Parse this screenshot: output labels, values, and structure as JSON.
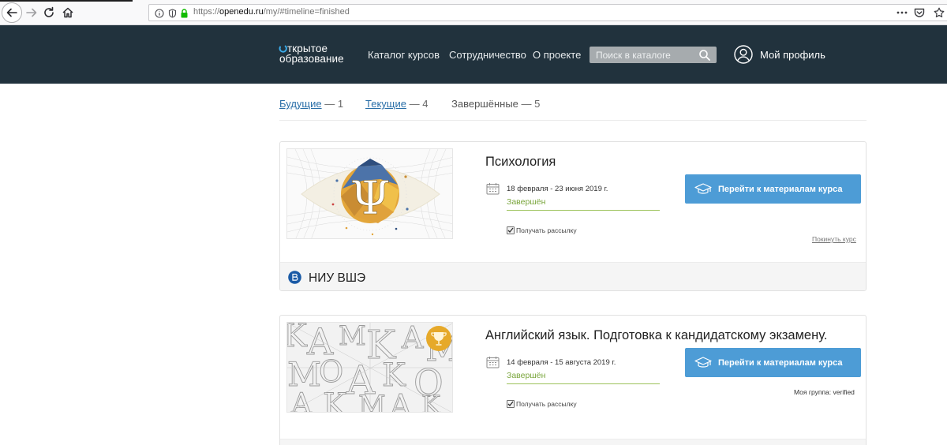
{
  "browser": {
    "url_prefix": "https://",
    "url_host": "openedu.ru",
    "url_path": "/my/#timeline=finished"
  },
  "header": {
    "logo_line1": "ткрытое",
    "logo_line2": "образование",
    "nav": [
      "Каталог курсов",
      "Сотрудничество",
      "О проекте"
    ],
    "search_placeholder": "Поиск в каталоге",
    "profile_label": "Мой профиль"
  },
  "timeline": {
    "tabs": [
      {
        "label": "Будущие",
        "count": "— 1",
        "active": false
      },
      {
        "label": "Текущие",
        "count": "— 4",
        "active": false
      },
      {
        "label": "Завершённые",
        "count": "— 5",
        "active": true
      }
    ]
  },
  "courses": [
    {
      "title": "Психология",
      "dates": "18 февраля - 23 июня 2019 г.",
      "status": "Завершён",
      "subscribe_label": "Получать рассылку",
      "subscribed": true,
      "button_label": "Перейти к материалам курса",
      "leave_label": "Покинуть курс",
      "university": "НИУ ВШЭ"
    },
    {
      "title": "Английский язык. Подготовка к кандидатскому экзамену.",
      "dates": "14 февраля - 15 августа 2019 г.",
      "status": "Завершён",
      "subscribe_label": "Получать рассылку",
      "subscribed": true,
      "button_label": "Перейти к материалам курса",
      "group_label": "Моя группа: verified"
    }
  ],
  "colors": {
    "header_bg": "#21323d",
    "button": "#4d9cd6",
    "status_green": "#79a53b",
    "link": "#2a6fa8"
  }
}
